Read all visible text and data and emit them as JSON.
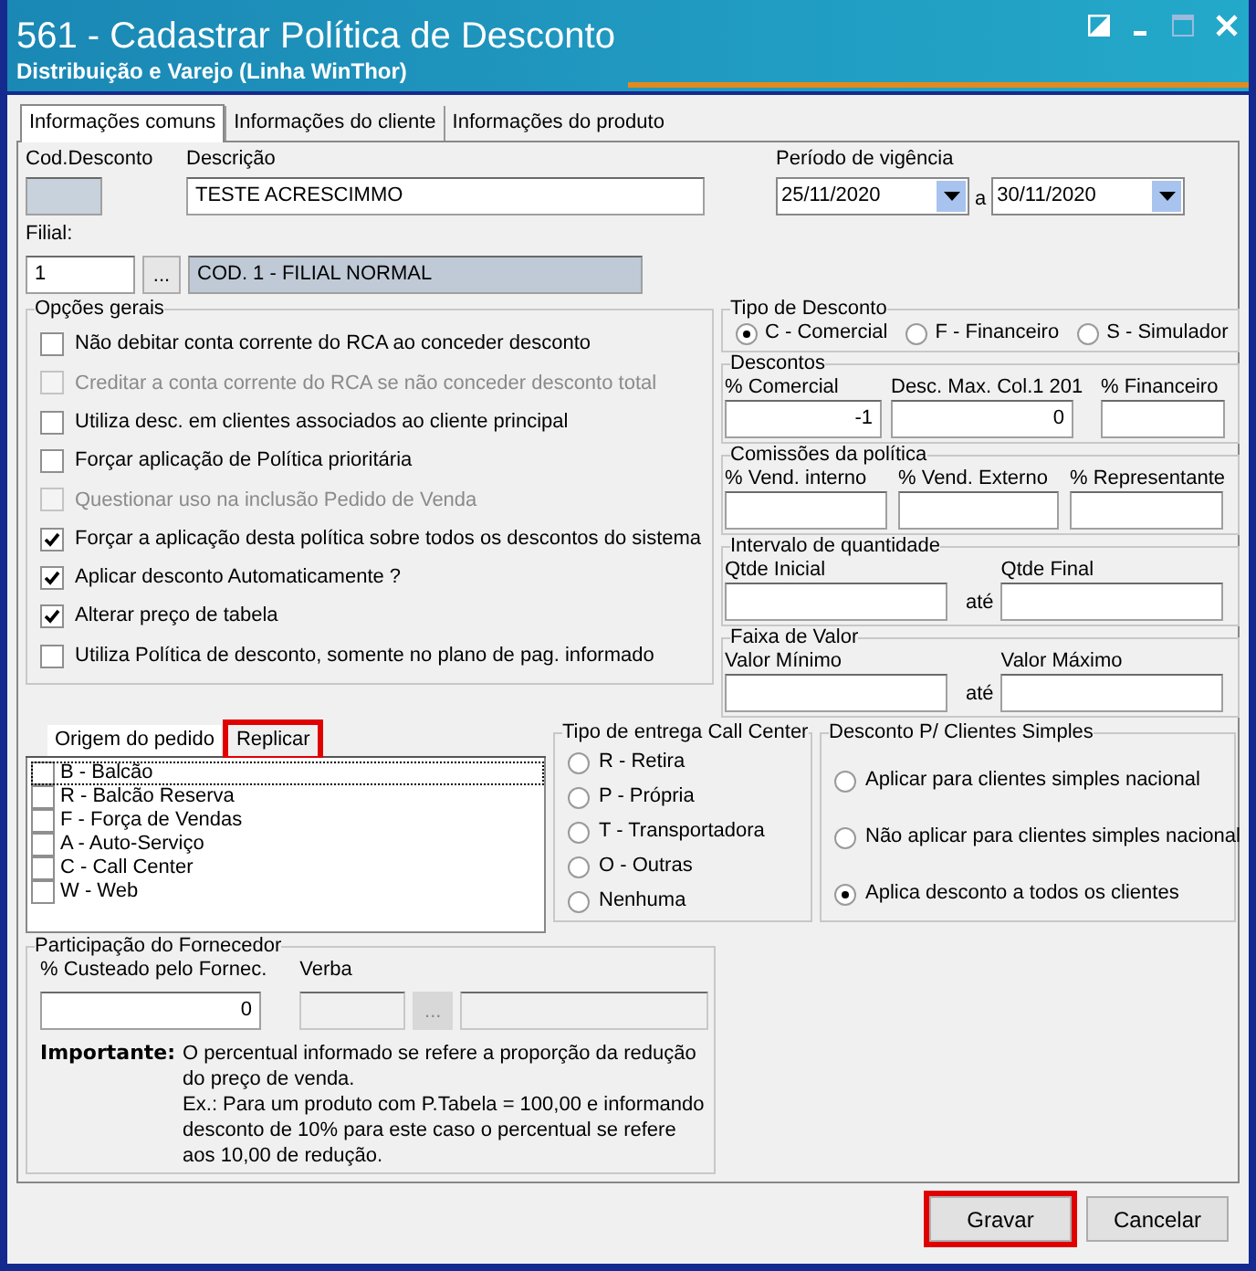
{
  "window": {
    "title": "561 - Cadastrar Política de Desconto",
    "subtitle": "Distribuição e Varejo (Linha WinThor)"
  },
  "tabs": [
    {
      "label": "Informações comuns",
      "selected": true
    },
    {
      "label": "Informações do cliente",
      "selected": false
    },
    {
      "label": "Informações do produto",
      "selected": false
    }
  ],
  "form": {
    "cod_desconto": {
      "label": "Cod.Desconto"
    },
    "descricao": {
      "label": "Descrição",
      "value": "TESTE ACRESCIMMO"
    },
    "periodo": {
      "label": "Período de vigência",
      "from": "25/11/2020",
      "separator": "a",
      "to": "30/11/2020"
    },
    "filial": {
      "label": "Filial:",
      "value": "1",
      "button": "...",
      "name": "COD. 1 - FILIAL NORMAL"
    }
  },
  "opcoes_gerais": {
    "title": "Opções gerais",
    "items": [
      {
        "label": "Não debitar conta corrente do RCA ao conceder desconto",
        "checked": false,
        "disabled": false
      },
      {
        "label": "Creditar a conta corrente do RCA se não conceder desconto total",
        "checked": false,
        "disabled": true
      },
      {
        "label": "Utiliza desc. em clientes associados ao cliente principal",
        "checked": false,
        "disabled": false
      },
      {
        "label": "Forçar aplicação de Política prioritária",
        "checked": false,
        "disabled": false
      },
      {
        "label": "Questionar uso na inclusão Pedido de Venda",
        "checked": false,
        "disabled": true
      },
      {
        "label": "Forçar a aplicação desta política sobre todos os descontos do sistema",
        "checked": true,
        "disabled": false
      },
      {
        "label": "Aplicar desconto Automaticamente ?",
        "checked": true,
        "disabled": false
      },
      {
        "label": "Alterar preço de tabela",
        "checked": true,
        "disabled": false
      },
      {
        "label": "Utiliza Política de desconto, somente no plano de pag. informado",
        "checked": false,
        "disabled": false
      }
    ]
  },
  "tipo_desconto": {
    "title": "Tipo de Desconto",
    "options": [
      {
        "label": "C - Comercial",
        "selected": true
      },
      {
        "label": "F - Financeiro",
        "selected": false
      },
      {
        "label": "S - Simulador",
        "selected": false
      }
    ]
  },
  "descontos": {
    "title": "Descontos",
    "fields": [
      {
        "label": "% Comercial",
        "value": "-1"
      },
      {
        "label": "Desc. Max. Col.1 201",
        "value": "0"
      },
      {
        "label": "% Financeiro"
      }
    ]
  },
  "comissoes": {
    "title": "Comissões da política",
    "fields": [
      {
        "label": "% Vend. interno"
      },
      {
        "label": "% Vend. Externo"
      },
      {
        "label": "% Representante"
      }
    ]
  },
  "intervalo": {
    "title": "Intervalo de quantidade",
    "from_label": "Qtde Inicial",
    "separator": "até",
    "to_label": "Qtde Final"
  },
  "faixa": {
    "title": "Faixa de Valor",
    "from_label": "Valor Mínimo",
    "separator": "até",
    "to_label": "Valor Máximo"
  },
  "origem": {
    "tabs": [
      {
        "label": "Origem do pedido",
        "selected": true,
        "highlighted": false
      },
      {
        "label": "Replicar",
        "selected": false,
        "highlighted": true
      }
    ],
    "items": [
      {
        "label": "B - Balcão",
        "checked": false,
        "focused": true
      },
      {
        "label": "R - Balcão Reserva",
        "checked": false,
        "focused": false
      },
      {
        "label": "F - Força de Vendas",
        "checked": false,
        "focused": false
      },
      {
        "label": "A - Auto-Serviço",
        "checked": false,
        "focused": false
      },
      {
        "label": "C - Call Center",
        "checked": false,
        "focused": false
      },
      {
        "label": "W - Web",
        "checked": false,
        "focused": false
      }
    ]
  },
  "tipo_entrega": {
    "title": "Tipo de entrega Call Center",
    "options": [
      {
        "label": "R - Retira",
        "selected": false
      },
      {
        "label": "P - Própria",
        "selected": false
      },
      {
        "label": "T - Transportadora",
        "selected": false
      },
      {
        "label": "O - Outras",
        "selected": false
      },
      {
        "label": "Nenhuma",
        "selected": false
      }
    ]
  },
  "clientes_simples": {
    "title": "Desconto P/ Clientes Simples",
    "options": [
      {
        "label": "Aplicar para clientes simples nacional",
        "selected": false
      },
      {
        "label": "Não aplicar para clientes simples nacional",
        "selected": false
      },
      {
        "label": "Aplica desconto a todos os clientes",
        "selected": true
      }
    ]
  },
  "participacao": {
    "title": "Participação do Fornecedor",
    "custeado": {
      "label": "% Custeado pelo Fornec.",
      "value": "0"
    },
    "verba": {
      "label": "Verba",
      "button": "..."
    },
    "note": {
      "label": "Importante:",
      "paragraphs": [
        "O percentual informado se refere a proporção da redução do preço de venda.",
        "Ex.: Para um produto com P.Tabela = 100,00 e informando desconto de 10% para este caso o percentual se refere aos 10,00 de redução."
      ]
    }
  },
  "buttons": [
    {
      "label": "Gravar",
      "highlighted": true
    },
    {
      "label": "Cancelar",
      "highlighted": false
    }
  ]
}
